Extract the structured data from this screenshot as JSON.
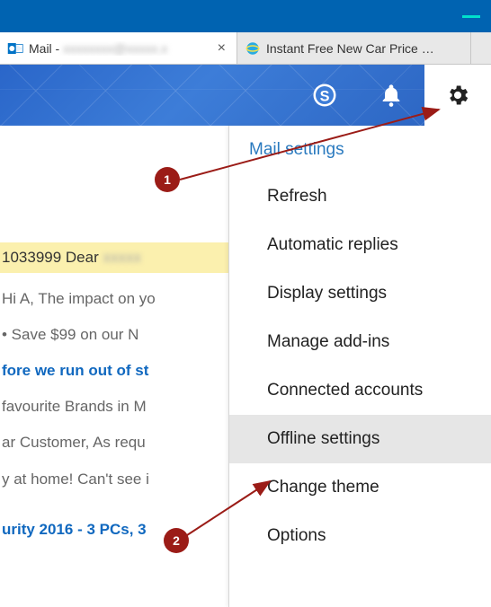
{
  "window": {
    "minimize": "minimize"
  },
  "tabs": {
    "active": {
      "prefix": "Mail - "
    },
    "inactive": {
      "title": "Instant Free New Car Price …"
    }
  },
  "header": {
    "skype": "skype-icon",
    "bell": "notifications-icon",
    "gear": "settings-icon"
  },
  "preview": {
    "r1": "1033999 Dear",
    "r2": "Hi A, The impact on yo",
    "r3": "• Save $99 on our N",
    "r4": "fore we run out of st",
    "r5": "favourite Brands in M",
    "r6": "ar Customer, As requ",
    "r7": "y at home! Can't see i",
    "r8": "urity 2016 - 3 PCs, 3"
  },
  "menu": {
    "title": "Mail settings",
    "items": {
      "refresh": "Refresh",
      "automatic_replies": "Automatic replies",
      "display_settings": "Display settings",
      "manage_addins": "Manage add-ins",
      "connected_accounts": "Connected accounts",
      "offline_settings": "Offline settings",
      "change_theme": "Change theme",
      "options": "Options"
    }
  },
  "callouts": {
    "one": "1",
    "two": "2"
  }
}
